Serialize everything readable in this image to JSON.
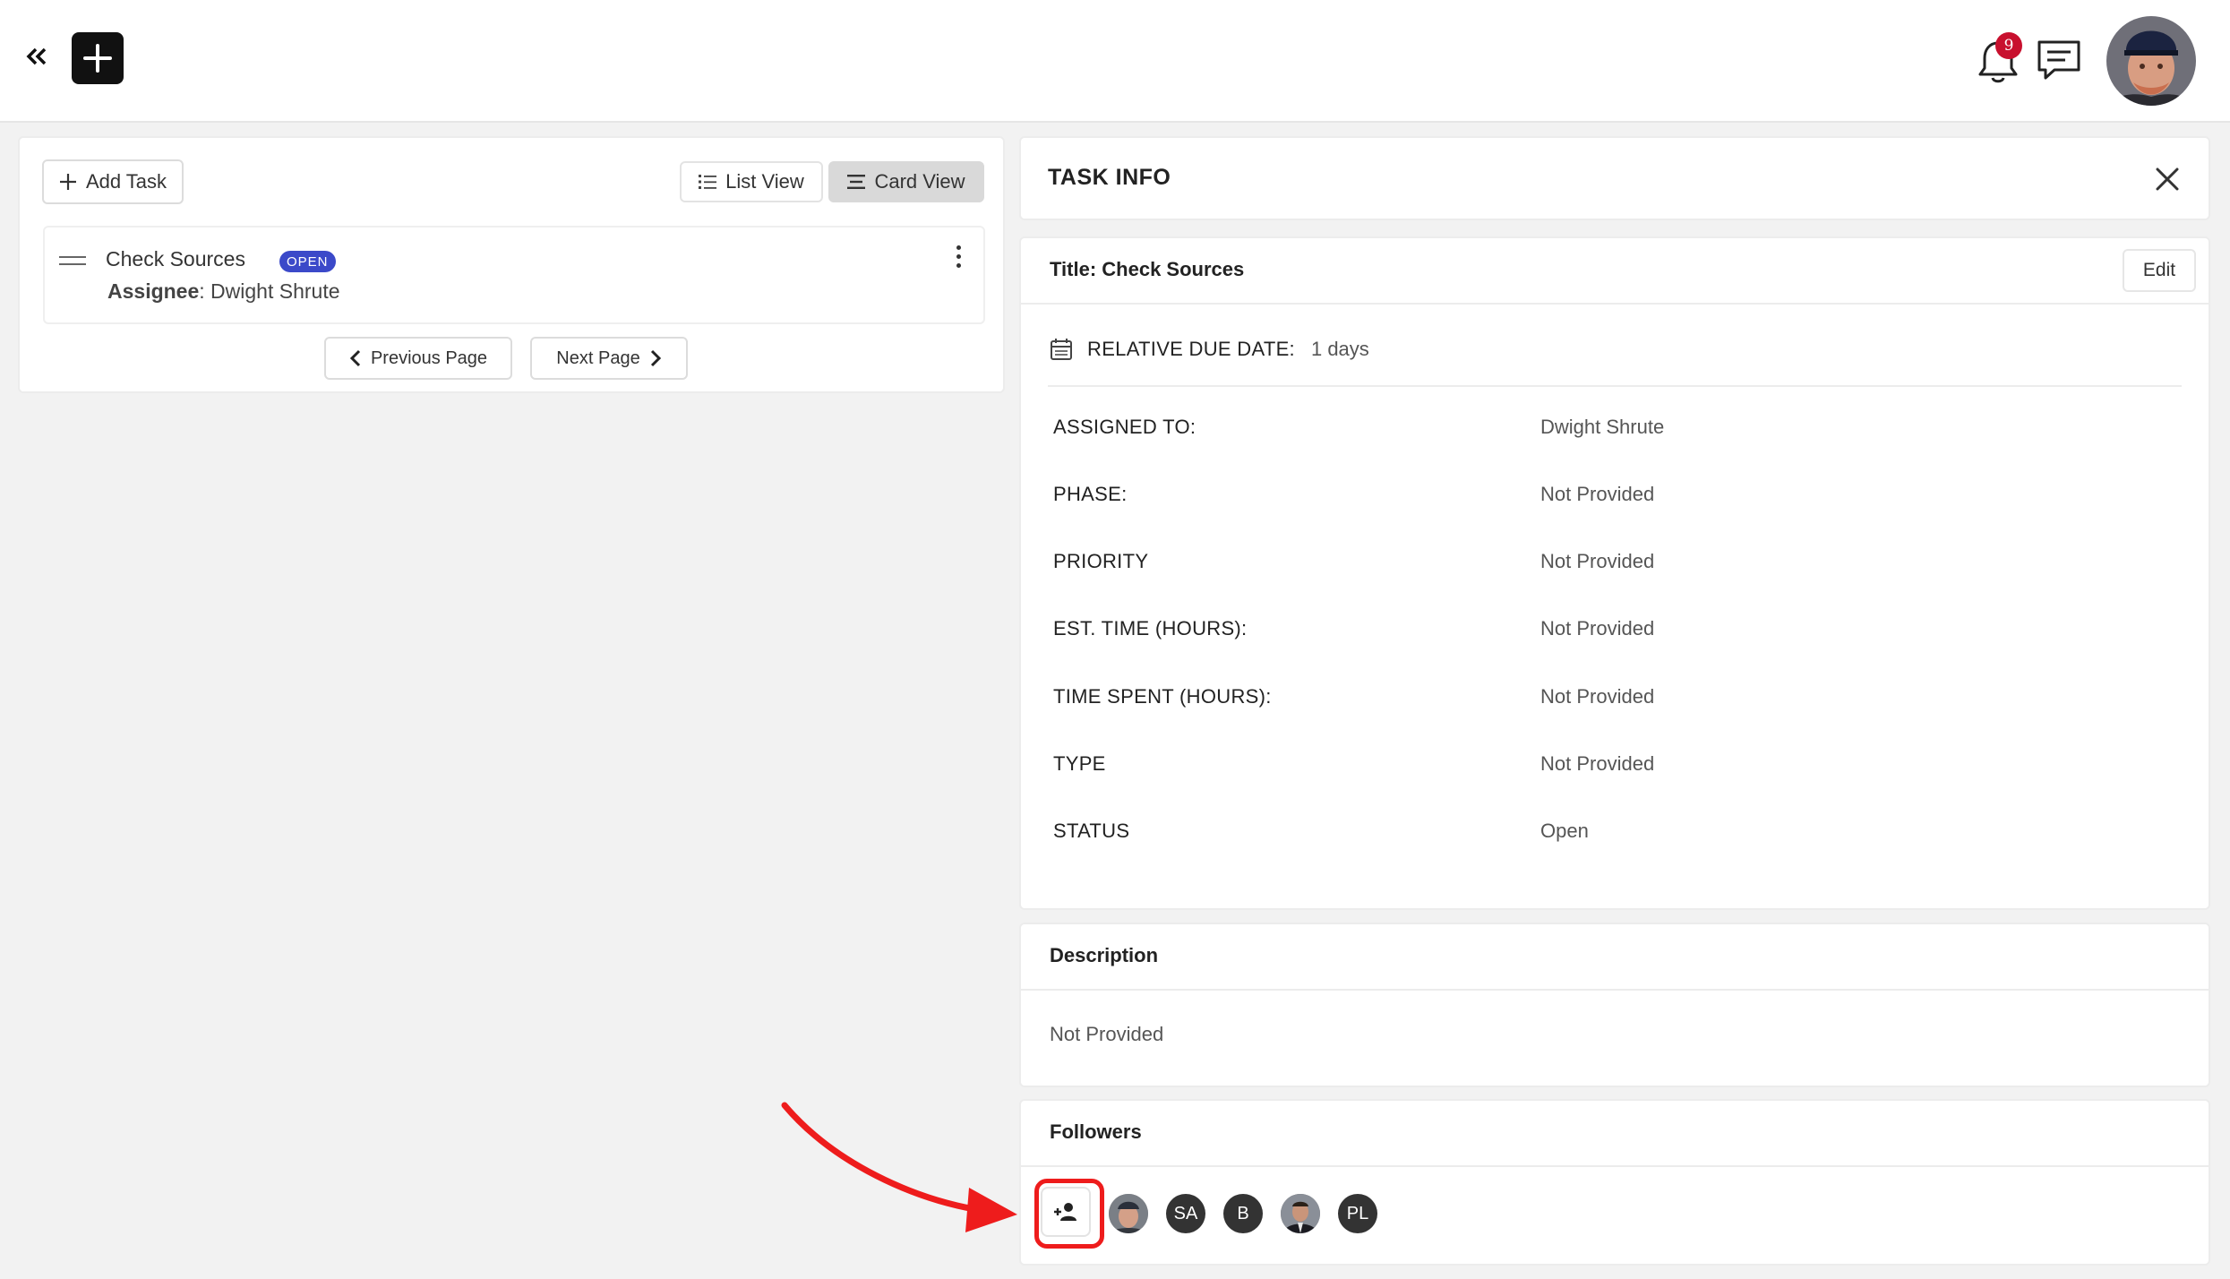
{
  "topbar": {
    "notification_count": "9",
    "icons": [
      "double-chevron-left-icon",
      "plus-icon",
      "bell-icon",
      "chat-icon",
      "user-avatar"
    ]
  },
  "left_panel": {
    "add_task_label": "Add Task",
    "list_view_label": "List View",
    "card_view_label": "Card View",
    "active_view": "Card View",
    "tasks": [
      {
        "title": "Check Sources",
        "status": "OPEN",
        "assignee_label": "Assignee",
        "assignee": ": Dwight Shrute"
      }
    ],
    "previous_page_label": "Previous Page",
    "next_page_label": "Next Page"
  },
  "task_info": {
    "header_title": "TASK INFO",
    "title_line": "Title: Check Sources",
    "edit_label": "Edit",
    "due_label": "RELATIVE DUE DATE:",
    "due_value": "1 days",
    "fields": [
      {
        "label": "ASSIGNED TO:",
        "value": "Dwight Shrute"
      },
      {
        "label": "PHASE:",
        "value": "Not Provided"
      },
      {
        "label": "PRIORITY",
        "value": "Not Provided"
      },
      {
        "label": "EST. TIME (HOURS):",
        "value": "Not Provided"
      },
      {
        "label": "TIME SPENT (HOURS):",
        "value": "Not Provided"
      },
      {
        "label": "TYPE",
        "value": "Not Provided"
      },
      {
        "label": "STATUS",
        "value": "Open"
      }
    ]
  },
  "description": {
    "title": "Description",
    "text": "Not Provided"
  },
  "followers": {
    "title": "Followers",
    "list": [
      {
        "type": "photo",
        "initials": ""
      },
      {
        "type": "initials",
        "initials": "SA"
      },
      {
        "type": "initials",
        "initials": "B"
      },
      {
        "type": "photo",
        "initials": ""
      },
      {
        "type": "initials",
        "initials": "PL"
      }
    ]
  },
  "colors": {
    "accent_dark": "#111111",
    "status_pill": "#3b49c9",
    "badge_red": "#c8102e",
    "annotation_red": "#ee1c1c",
    "avatar_dark": "#333333"
  }
}
